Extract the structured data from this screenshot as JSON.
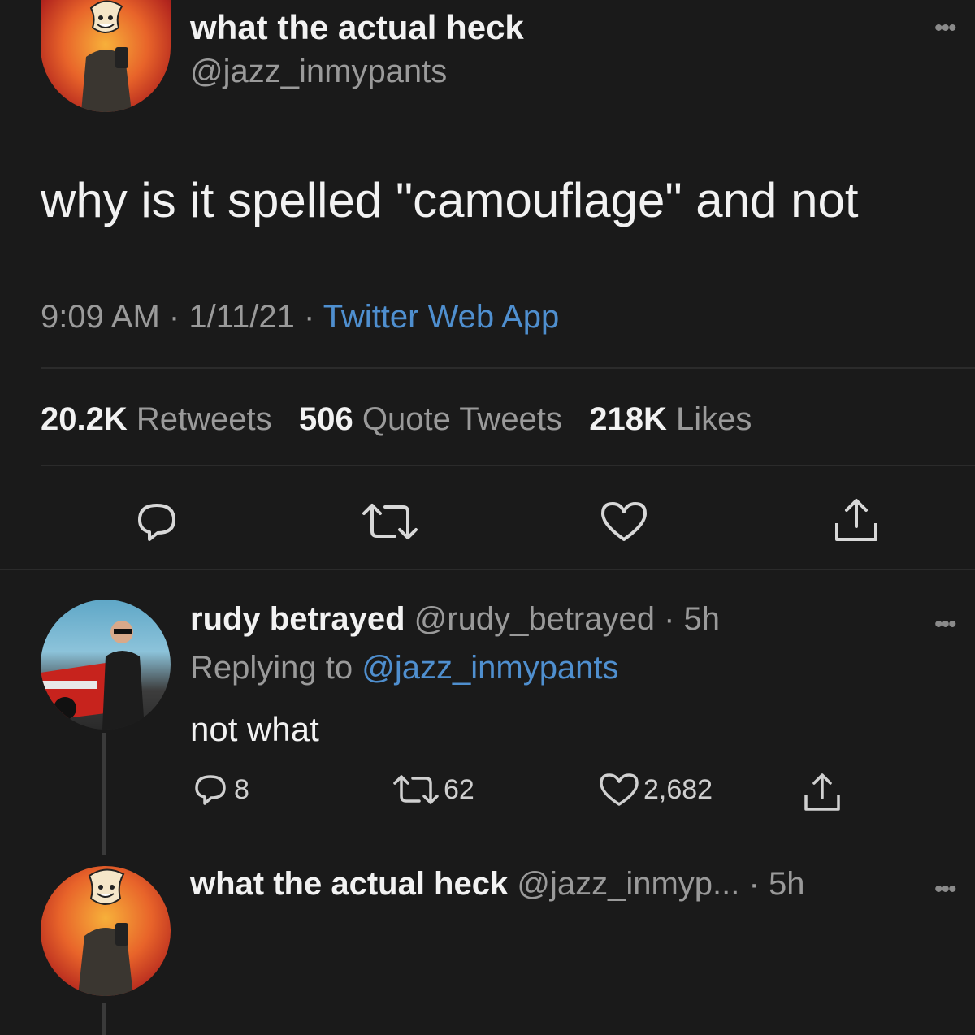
{
  "main_tweet": {
    "display_name": "what the actual heck",
    "handle": "@jazz_inmypants",
    "text": "why is it spelled \"camouflage\" and not",
    "time": "9:09 AM",
    "sep1": "·",
    "date": "1/11/21",
    "sep2": "·",
    "source": "Twitter Web App",
    "stats": {
      "retweets_count": "20.2K",
      "retweets_label": "Retweets",
      "quotes_count": "506",
      "quotes_label": "Quote Tweets",
      "likes_count": "218K",
      "likes_label": "Likes"
    },
    "more_icon": "more-dots-icon",
    "action_icons": [
      "reply-icon",
      "retweet-icon",
      "like-icon",
      "share-icon"
    ]
  },
  "reply_1": {
    "display_name": "rudy betrayed",
    "handle": "@rudy_betrayed",
    "dot_time": "· 5h",
    "replying_prefix": "Replying to",
    "replying_handle": "@jazz_inmypants",
    "text": "not what",
    "reply_count": "8",
    "retweet_count": "62",
    "like_count": "2,682"
  },
  "reply_2": {
    "display_name": "what the actual heck",
    "handle": "@jazz_inmyp...",
    "dot_time": "· 5h"
  },
  "colors": {
    "background": "#1a1a1a",
    "link_blue": "#4f8fcf",
    "muted_text": "#9a9a9a",
    "primary_text": "#f2f2f2"
  }
}
